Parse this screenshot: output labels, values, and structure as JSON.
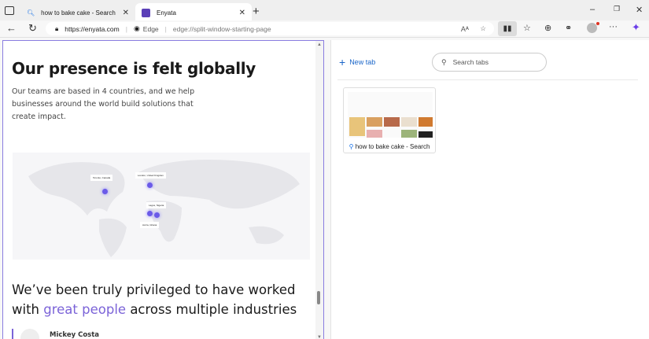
{
  "tabs": [
    {
      "title": "how to bake cake - Search",
      "icon": "search-icon"
    },
    {
      "title": "Enyata",
      "icon": "enyata-logo-icon",
      "active": true
    }
  ],
  "address": {
    "url": "https://enyata.com",
    "split_label": "Edge",
    "split_url": "edge://split-window-starting-page"
  },
  "left": {
    "heading": "Our presence is felt globally",
    "intro": "Our teams are based in 4 countries, and we help businesses around the world build solutions that create impact.",
    "map_labels": [
      "Toronto, Canada",
      "London, United Kingdom",
      "Lagos, Nigeria",
      "Accra, Ghana"
    ],
    "heading2_a": "We’ve been truly privileged to have worked with ",
    "heading2_hl": "great people",
    "heading2_b": " across multiple industries",
    "testimonial_name": "Mickey Costa",
    "accent": "#7b63d8"
  },
  "right": {
    "new_tab": "New tab",
    "search_placeholder": "Search tabs",
    "tab_card_title": "how to bake cake - Search"
  }
}
